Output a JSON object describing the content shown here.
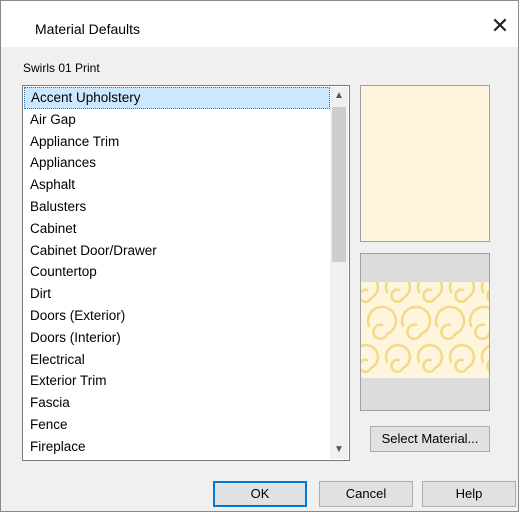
{
  "window": {
    "title": "Material Defaults",
    "close_glyph": "✕"
  },
  "material_name": "Swirls 01 Print",
  "list": {
    "selected_index": 0,
    "items": [
      "Accent Upholstery",
      "Air Gap",
      "Appliance Trim",
      "Appliances",
      "Asphalt",
      "Balusters",
      "Cabinet",
      "Cabinet Door/Drawer",
      "Countertop",
      "Dirt",
      "Doors (Exterior)",
      "Doors (Interior)",
      "Electrical",
      "Exterior Trim",
      "Fascia",
      "Fence",
      "Fireplace"
    ],
    "scroll_up_glyph": "▲",
    "scroll_down_glyph": "▼"
  },
  "preview": {
    "color_hex": "#fdf5dc",
    "texture_colors": {
      "background": "#fdf5dc",
      "swirl": "#f3d98a",
      "frame": "#dcdcdc"
    }
  },
  "buttons": {
    "select_material": "Select Material...",
    "ok": "OK",
    "cancel": "Cancel",
    "help": "Help"
  },
  "colors": {
    "selection": "#cce8ff",
    "default_button_border": "#0078d7"
  }
}
